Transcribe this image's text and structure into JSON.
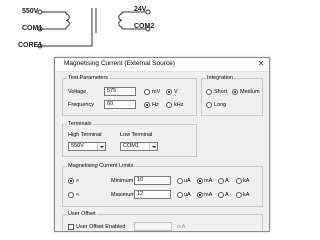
{
  "diagram": {
    "left_terminals": [
      "550V",
      "COM1",
      "CORE1"
    ],
    "right_terminals": [
      "24V",
      "COM2"
    ]
  },
  "dialog": {
    "title": "Magnetising Current (External Source)",
    "close_glyph": "✕",
    "test_parameters": {
      "title": "Test Parameters",
      "voltage_label": "Voltage",
      "voltage_value": "575",
      "voltage_units": [
        {
          "label": "mV",
          "selected": false
        },
        {
          "label": "V",
          "selected": true
        }
      ],
      "frequency_label": "Frequency",
      "frequency_value": "60",
      "frequency_units": [
        {
          "label": "Hz",
          "selected": true
        },
        {
          "label": "kHz",
          "selected": false
        }
      ]
    },
    "integration": {
      "title": "Integration",
      "options": [
        {
          "label": "Short",
          "selected": false
        },
        {
          "label": "Medium",
          "selected": true
        },
        {
          "label": "Long",
          "selected": false
        }
      ]
    },
    "terminals": {
      "title": "Terminals",
      "high_label": "High Terminal",
      "high_value": "550V",
      "low_label": "Low Terminal",
      "low_value": "COM1"
    },
    "limits": {
      "title": "Magnetising Current Limits",
      "gt_symbol": ">",
      "lt_symbol": "<",
      "gt_selected": true,
      "lt_selected": false,
      "minimum_label": "Minimum",
      "minimum_value": "10",
      "maximum_label": "Maximum",
      "maximum_value": "12",
      "min_units": [
        {
          "label": "uA",
          "selected": false
        },
        {
          "label": "mA",
          "selected": true
        },
        {
          "label": "A",
          "selected": false
        },
        {
          "label": "kA",
          "selected": false
        }
      ],
      "max_units": [
        {
          "label": "uA",
          "selected": false
        },
        {
          "label": "mA",
          "selected": true
        },
        {
          "label": "A",
          "selected": false
        },
        {
          "label": "kA",
          "selected": false
        }
      ]
    },
    "user_offset": {
      "title": "User Offset",
      "enabled_label": "User Offset Enabled",
      "unit": "mA"
    }
  }
}
